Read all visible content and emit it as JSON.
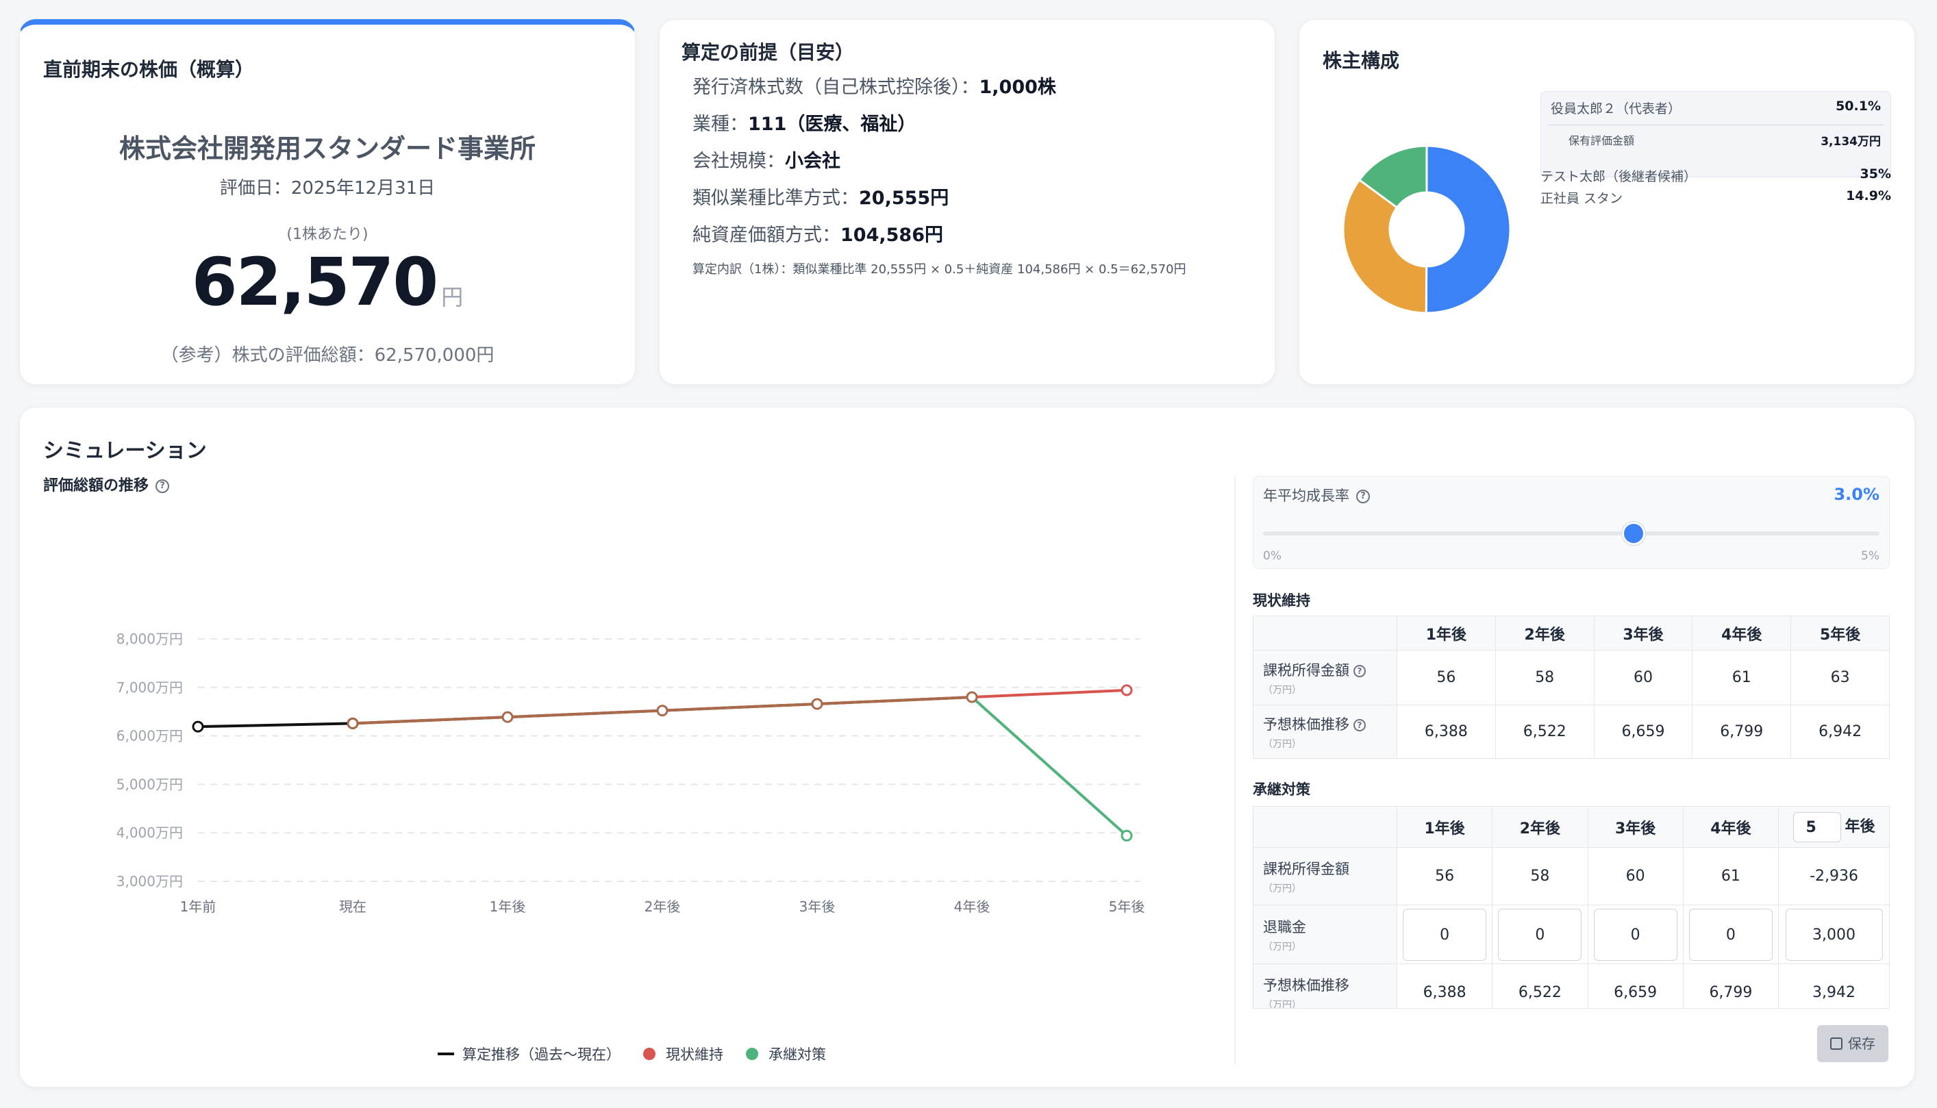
{
  "price_card": {
    "title": "直前期末の株価（概算）",
    "company": "株式会社開発用スタンダード事業所",
    "date": "評価日：2025年12月31日",
    "per_share": "(1株あたり)",
    "price": "62,570",
    "unit": "円",
    "total": "（参考）株式の評価総額：62,570,000円"
  },
  "premise": {
    "title": "算定の前提（目安）",
    "lines": [
      {
        "label": "発行済株式数（自己株式控除後）：",
        "value": "1,000株"
      },
      {
        "label": "業種：",
        "value": "111",
        "suffix": "（医療、福祉）"
      },
      {
        "label": "会社規模：",
        "value": "小会社"
      },
      {
        "label": "類似業種比準方式：",
        "value": "20,555円"
      },
      {
        "label": "純資産価額方式：",
        "value": "104,586円"
      }
    ],
    "detail": "算定内訳（1株）：類似業種比準 20,555円 × 0.5＋純資産 104,586円 × 0.5＝62,570円"
  },
  "holders": {
    "title": "株主構成",
    "items": [
      {
        "name": "役員太郎２（代表者）",
        "pct": "50.1%",
        "value": 50.1,
        "color": "#3b82f6"
      },
      {
        "name": "テスト太郎（後継者候補）",
        "pct": "35%",
        "value": 35,
        "color": "#e9a23b"
      },
      {
        "name": "正社員 スタン",
        "pct": "14.9%",
        "value": 14.9,
        "color": "#4fb37c"
      }
    ],
    "sub_label": "保有評価金額",
    "sub_value": "3,134万円"
  },
  "simulation": {
    "title": "シミュレーション",
    "chart_title": "評価総額の推移",
    "help": "?",
    "rate_label": "年平均成長率",
    "rate_value": "3.0%",
    "rate_fraction": 0.6,
    "slider_min": "0%",
    "slider_max": "5%",
    "status_quo": {
      "title": "現状維持",
      "headers": [
        "1年後",
        "2年後",
        "3年後",
        "4年後",
        "5年後"
      ],
      "rows": [
        {
          "label": "課税所得金額",
          "unit": "（万円）",
          "values": [
            "56",
            "58",
            "60",
            "61",
            "63"
          ]
        },
        {
          "label": "予想株価推移",
          "unit": "（万円）",
          "values": [
            "6,388",
            "6,522",
            "6,659",
            "6,799",
            "6,942"
          ]
        }
      ]
    },
    "succession": {
      "title": "承継対策",
      "headers": [
        "1年後",
        "2年後",
        "3年後",
        "4年後"
      ],
      "year_input": "5",
      "year_suffix": "年後",
      "rows": [
        {
          "label": "課税所得金額",
          "unit": "（万円）",
          "values": [
            "56",
            "58",
            "60",
            "61",
            "-2,936"
          ]
        },
        {
          "label": "退職金",
          "unit": "（万円）",
          "values": [
            "0",
            "0",
            "0",
            "0",
            "3,000"
          ]
        },
        {
          "label": "予想株価推移",
          "unit": "（万円）",
          "values": [
            "6,388",
            "6,522",
            "6,659",
            "6,799",
            "3,942"
          ]
        }
      ]
    },
    "save_label": "保存"
  },
  "chart_data": {
    "type": "line",
    "categories": [
      "1年前",
      "現在",
      "1年後",
      "2年後",
      "3年後",
      "4年後",
      "5年後"
    ],
    "ylim": [
      3000,
      8000
    ],
    "yticks": [
      3000,
      4000,
      5000,
      6000,
      7000,
      8000
    ],
    "ytick_labels": [
      "3,000万円",
      "4,000万円",
      "5,000万円",
      "6,000万円",
      "7,000万円",
      "8,000万円"
    ],
    "grid": true,
    "legend_position": "bottom",
    "series": [
      {
        "name": "算定推移（過去〜現在）",
        "color": "#111111",
        "values": [
          6190,
          6257,
          null,
          null,
          null,
          null,
          null
        ]
      },
      {
        "name": "現状維持",
        "color": "#d9534f",
        "values": [
          null,
          6257,
          6388,
          6522,
          6659,
          6799,
          6942
        ]
      },
      {
        "name": "承継対策",
        "color": "#4fb37c",
        "values": [
          null,
          6257,
          6388,
          6522,
          6659,
          6799,
          3942
        ]
      }
    ]
  }
}
